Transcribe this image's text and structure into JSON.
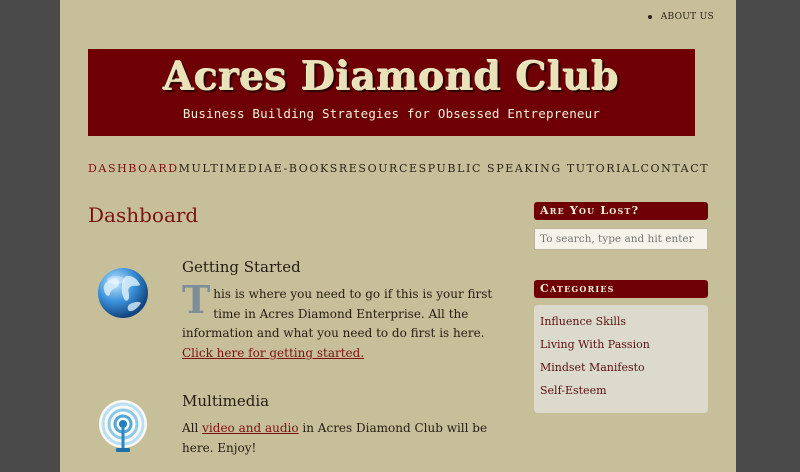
{
  "top_nav": {
    "about_label": "ABOUT US"
  },
  "banner": {
    "title": "Acres Diamond Club",
    "subtitle": "Business Building Strategies for Obsessed Entrepreneur"
  },
  "main_nav": {
    "items": [
      {
        "label": "DASHBOARD",
        "active": true
      },
      {
        "label": "MULTIMEDIA"
      },
      {
        "label": "E-BOOKS"
      },
      {
        "label": "RESOURCES"
      },
      {
        "label": "PUBLIC SPEAKING TUTORIAL"
      },
      {
        "label": "CONTACT"
      }
    ]
  },
  "content": {
    "heading": "Dashboard",
    "posts": [
      {
        "icon": "globe-icon",
        "title": "Getting Started",
        "dropcap": "T",
        "text": "his is where you need to go if this is your first time in Acres Diamond Enterprise. All the information and what you need to do first is here. ",
        "link": "Click here for getting started."
      },
      {
        "icon": "broadcast-icon",
        "title": "Multimedia",
        "text_before": "All ",
        "link": "video and audio",
        "text_after": " in Acres Diamond Club will be here. Enjoy!"
      }
    ]
  },
  "sidebar": {
    "lost_title": "Are You Lost?",
    "search_placeholder": "To search, type and hit enter",
    "categories_title": "Categories",
    "categories": [
      "Influence Skills",
      "Living With Passion",
      "Mindset Manifesto",
      "Self-Esteem"
    ]
  },
  "colors": {
    "page_bg": "#c7bf9a",
    "outer_bg": "#4a4a4a",
    "brand_red": "#6e0005",
    "accent_red": "#7a1212"
  }
}
